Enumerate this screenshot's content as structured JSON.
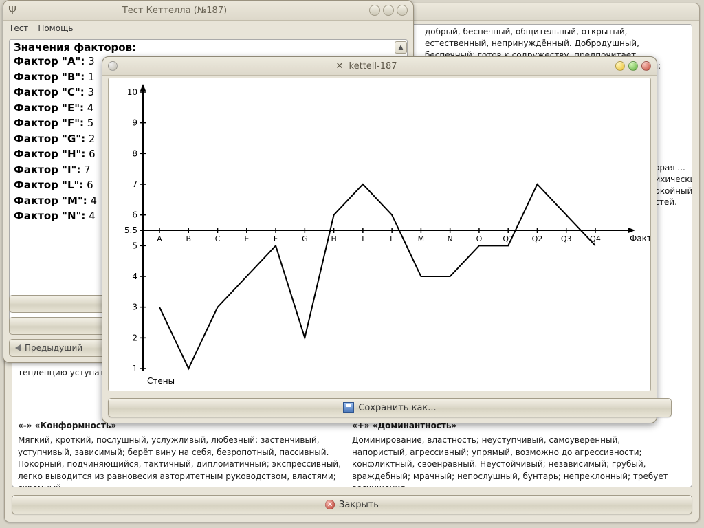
{
  "main_window": {
    "top_text": "добрый, беспечный, общительный, открытый, естественный, непринуждённый. Добродушный, беспечный; готов к содружеству, предпочитает присоединяться; сердечный, внимательный к людям;",
    "middle_text": "тенденцию уступать... Покорный, проблематичных ситуаций; утомляемость.",
    "side_text": "вторая ... психически спокойный; отстей.",
    "left_col": {
      "title": "«-» «Конформность»",
      "body": "Мягкий, кроткий, послушный, услужливый, любезный; застенчивый, уступчивый, зависимый; берёт вину на себя, безропотный, пассивный. Покорный, подчиняющийся, тактичный, дипломатичный; экспрессивный, легко выводится из равновесия авторитетным руководством, властями; скромный."
    },
    "right_col": {
      "title": "«+» «Доминантность»",
      "body": "Доминирование, властность; неуступчивый, самоуверенный, напористый, агрессивный; упрямый, возможно до агрессивности; конфликтный, своенравный. Неустойчивый; независимый; грубый, враждебный; мрачный; непослушный, бунтарь; непреклонный; требует восхищения."
    },
    "close_label": "Закрыть"
  },
  "list_window": {
    "title": "Тест Кеттелла (№187)",
    "menu": {
      "test": "Тест",
      "help": "Помощь"
    },
    "heading": "Значения факторов:",
    "factors": [
      {
        "name": "Фактор \"A\":",
        "value": 3
      },
      {
        "name": "Фактор \"B\":",
        "value": 1
      },
      {
        "name": "Фактор \"C\":",
        "value": 3
      },
      {
        "name": "Фактор \"E\":",
        "value": 4
      },
      {
        "name": "Фактор \"F\":",
        "value": 5
      },
      {
        "name": "Фактор \"G\":",
        "value": 2
      },
      {
        "name": "Фактор \"H\":",
        "value": 6
      },
      {
        "name": "Фактор \"I\":",
        "value": 7
      },
      {
        "name": "Фактор \"L\":",
        "value": 6
      },
      {
        "name": "Фактор \"M\":",
        "value": 4
      },
      {
        "name": "Фактор \"N\":",
        "value": 4
      }
    ],
    "prev_button": "Предыдущий"
  },
  "chart_window": {
    "title": "kettell-187",
    "save_label": "Сохранить как...",
    "axis_label_x": "Фактор",
    "axis_label_y": "Стены"
  },
  "chart_data": {
    "type": "line",
    "title": "",
    "xlabel": "Фактор",
    "ylabel": "Стены",
    "ylim": [
      1,
      10
    ],
    "yticks": [
      1,
      2,
      3,
      4,
      5,
      5.5,
      6,
      7,
      8,
      9,
      10
    ],
    "categories": [
      "A",
      "B",
      "C",
      "E",
      "F",
      "G",
      "H",
      "I",
      "L",
      "M",
      "N",
      "O",
      "Q1",
      "Q2",
      "Q3",
      "Q4"
    ],
    "values": [
      3,
      1,
      3,
      4,
      5,
      2,
      6,
      7,
      6,
      4,
      4,
      5,
      5,
      7,
      6,
      5
    ],
    "baseline": 5.5
  }
}
